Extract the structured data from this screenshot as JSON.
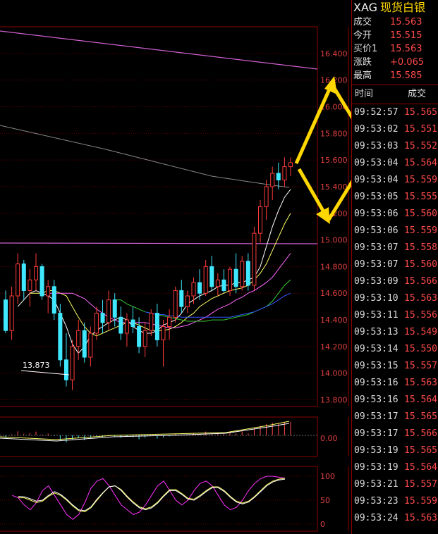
{
  "chart_data": {
    "type": "candlestick",
    "y_ticks_main": [
      "16.400",
      "16.200",
      "16.000",
      "15.800",
      "15.600",
      "15.400",
      "15.200",
      "15.000",
      "14.800",
      "14.600",
      "14.400",
      "14.200",
      "14.000",
      "13.800"
    ],
    "ylim": [
      13.75,
      16.6
    ],
    "annotation_low": "13.873",
    "candles": [
      [
        14.55,
        14.62,
        14.3,
        14.32
      ],
      [
        14.32,
        14.65,
        14.25,
        14.58
      ],
      [
        14.58,
        14.9,
        14.52,
        14.82
      ],
      [
        14.82,
        14.85,
        14.55,
        14.62
      ],
      [
        14.62,
        14.78,
        14.5,
        14.7
      ],
      [
        14.7,
        14.9,
        14.62,
        14.8
      ],
      [
        14.8,
        14.82,
        14.55,
        14.58
      ],
      [
        14.58,
        14.7,
        14.45,
        14.65
      ],
      [
        14.65,
        14.7,
        14.4,
        14.45
      ],
      [
        14.45,
        14.52,
        14.05,
        14.1
      ],
      [
        14.1,
        14.3,
        13.9,
        13.95
      ],
      [
        13.95,
        14.25,
        13.873,
        14.2
      ],
      [
        14.2,
        14.4,
        14.1,
        14.32
      ],
      [
        14.32,
        14.38,
        14.08,
        14.12
      ],
      [
        14.12,
        14.35,
        14.05,
        14.3
      ],
      [
        14.3,
        14.5,
        14.25,
        14.45
      ],
      [
        14.45,
        14.55,
        14.3,
        14.38
      ],
      [
        14.38,
        14.62,
        14.32,
        14.55
      ],
      [
        14.55,
        14.6,
        14.35,
        14.42
      ],
      [
        14.42,
        14.5,
        14.25,
        14.3
      ],
      [
        14.3,
        14.45,
        14.2,
        14.4
      ],
      [
        14.4,
        14.5,
        14.3,
        14.35
      ],
      [
        14.35,
        14.42,
        14.15,
        14.2
      ],
      [
        14.2,
        14.38,
        14.12,
        14.32
      ],
      [
        14.32,
        14.48,
        14.28,
        14.45
      ],
      [
        14.45,
        14.52,
        14.2,
        14.25
      ],
      [
        14.25,
        14.4,
        14.05,
        14.35
      ],
      [
        14.35,
        14.48,
        14.25,
        14.42
      ],
      [
        14.42,
        14.65,
        14.38,
        14.62
      ],
      [
        14.62,
        14.7,
        14.45,
        14.5
      ],
      [
        14.5,
        14.62,
        14.45,
        14.58
      ],
      [
        14.58,
        14.72,
        14.52,
        14.68
      ],
      [
        14.68,
        14.78,
        14.55,
        14.6
      ],
      [
        14.6,
        14.85,
        14.58,
        14.8
      ],
      [
        14.8,
        14.88,
        14.62,
        14.65
      ],
      [
        14.65,
        14.75,
        14.58,
        14.7
      ],
      [
        14.7,
        14.78,
        14.6,
        14.62
      ],
      [
        14.62,
        14.8,
        14.58,
        14.78
      ],
      [
        14.78,
        14.9,
        14.6,
        14.65
      ],
      [
        14.65,
        14.88,
        14.62,
        14.84
      ],
      [
        14.84,
        14.9,
        14.62,
        14.66
      ],
      [
        14.66,
        15.1,
        14.62,
        15.05
      ],
      [
        15.05,
        15.3,
        14.98,
        15.25
      ],
      [
        15.25,
        15.45,
        15.15,
        15.4
      ],
      [
        15.4,
        15.55,
        15.3,
        15.5
      ],
      [
        15.5,
        15.58,
        15.38,
        15.45
      ],
      [
        15.45,
        15.62,
        15.4,
        15.55
      ],
      [
        15.55,
        15.62,
        15.48,
        15.58
      ]
    ],
    "ma_lines": [
      {
        "color": "#ffffff",
        "values": [
          14.5,
          14.55,
          14.6,
          14.62,
          14.6,
          14.58,
          14.55,
          14.45,
          14.35,
          14.22,
          14.15,
          14.2,
          14.28,
          14.32,
          14.35,
          14.38,
          14.4,
          14.42,
          14.4,
          14.35,
          14.32,
          14.3,
          14.3,
          14.32,
          14.36,
          14.38,
          14.4,
          14.45,
          14.52,
          14.55,
          14.58,
          14.6,
          14.62,
          14.65,
          14.66,
          14.66,
          14.68,
          14.68,
          14.7,
          14.72,
          14.8,
          14.95,
          15.1,
          15.22,
          15.32,
          15.38
        ]
      },
      {
        "color": "#ffff66",
        "values": [
          14.6,
          14.6,
          14.6,
          14.62,
          14.62,
          14.6,
          14.58,
          14.5,
          14.42,
          14.35,
          14.3,
          14.28,
          14.3,
          14.32,
          14.34,
          14.36,
          14.38,
          14.38,
          14.36,
          14.34,
          14.32,
          14.32,
          14.32,
          14.33,
          14.35,
          14.38,
          14.42,
          14.45,
          14.5,
          14.53,
          14.56,
          14.58,
          14.6,
          14.62,
          14.63,
          14.64,
          14.66,
          14.7,
          14.75,
          14.82,
          14.92,
          15.02,
          15.12,
          15.2
        ]
      },
      {
        "color": "#ff66ff",
        "values": [
          14.6,
          14.6,
          14.6,
          14.6,
          14.6,
          14.58,
          14.56,
          14.52,
          14.48,
          14.45,
          14.42,
          14.4,
          14.38,
          14.38,
          14.38,
          14.38,
          14.38,
          14.37,
          14.36,
          14.35,
          14.34,
          14.34,
          14.35,
          14.36,
          14.38,
          14.4,
          14.42,
          14.45,
          14.48,
          14.5,
          14.52,
          14.55,
          14.57,
          14.6,
          14.62,
          14.65,
          14.68,
          14.72,
          14.78,
          14.84,
          14.9
        ]
      },
      {
        "color": "#33cc33",
        "values": [
          14.55,
          14.55,
          14.52,
          14.5,
          14.48,
          14.46,
          14.45,
          14.44,
          14.43,
          14.42,
          14.41,
          14.4,
          14.39,
          14.39,
          14.39,
          14.39,
          14.4,
          14.4,
          14.4,
          14.41,
          14.42,
          14.43,
          14.44,
          14.46,
          14.48,
          14.5,
          14.54,
          14.6,
          14.66,
          14.7
        ]
      },
      {
        "color": "#3355ff",
        "values": [
          14.46,
          14.45,
          14.44,
          14.44,
          14.43,
          14.43,
          14.42,
          14.42,
          14.42,
          14.42,
          14.42,
          14.42,
          14.42,
          14.42,
          14.42,
          14.43,
          14.44,
          14.45,
          14.46,
          14.48,
          14.5,
          14.52,
          14.55,
          14.58,
          14.6
        ]
      }
    ],
    "macd_tick": "0.00",
    "kdj_ticks": [
      "100",
      "50",
      "0"
    ],
    "kdj_lines": [
      {
        "color": "#ff33ff",
        "values": [
          60,
          55,
          40,
          30,
          45,
          70,
          80,
          60,
          40,
          20,
          10,
          20,
          45,
          75,
          90,
          95,
          80,
          60,
          40,
          30,
          20,
          25,
          40,
          60,
          80,
          90,
          70,
          50,
          40,
          50,
          70,
          85,
          90,
          80,
          60,
          40,
          30,
          35,
          50,
          70,
          85,
          95,
          100,
          100,
          98,
          96
        ]
      },
      {
        "color": "#ffff66",
        "values": [
          55,
          55,
          50,
          45,
          48,
          58,
          65,
          60,
          50,
          38,
          28,
          26,
          34,
          50,
          65,
          78,
          80,
          72,
          58,
          46,
          36,
          32,
          36,
          46,
          60,
          72,
          72,
          64,
          54,
          52,
          60,
          70,
          78,
          78,
          70,
          58,
          48,
          44,
          48,
          58,
          70,
          82,
          90,
          94,
          96
        ]
      },
      {
        "color": "#ffffff",
        "values": [
          58,
          57,
          53,
          48,
          50,
          60,
          68,
          62,
          52,
          40,
          30,
          28,
          36,
          52,
          66,
          78,
          80,
          70,
          56,
          44,
          34,
          30,
          34,
          44,
          58,
          70,
          70,
          62,
          52,
          50,
          58,
          68,
          76,
          76,
          68,
          56,
          46,
          42,
          46,
          56,
          68,
          80,
          88,
          92,
          94
        ]
      }
    ]
  },
  "quote": {
    "symbol": "XAG",
    "name": "现货白银",
    "rows": [
      {
        "label": "成交",
        "value": "15.563"
      },
      {
        "label": "今开",
        "value": "15.515"
      },
      {
        "label": "买价1",
        "value": "15.563"
      },
      {
        "label": "涨跌",
        "value": "+0.065"
      },
      {
        "label": "最高",
        "value": "15.585"
      }
    ]
  },
  "ticks_header": {
    "time": "时间",
    "price": "成交"
  },
  "ticks": [
    {
      "t": "09:52:57",
      "p": "15.565"
    },
    {
      "t": "09:53:02",
      "p": "15.551"
    },
    {
      "t": "09:53:03",
      "p": "15.552"
    },
    {
      "t": "09:53:04",
      "p": "15.564"
    },
    {
      "t": "09:53:04",
      "p": "15.559"
    },
    {
      "t": "09:53:05",
      "p": "15.555"
    },
    {
      "t": "09:53:06",
      "p": "15.560"
    },
    {
      "t": "09:53:06",
      "p": "15.559"
    },
    {
      "t": "09:53:07",
      "p": "15.558"
    },
    {
      "t": "09:53:07",
      "p": "15.560"
    },
    {
      "t": "09:53:09",
      "p": "15.566"
    },
    {
      "t": "09:53:10",
      "p": "15.563"
    },
    {
      "t": "09:53:11",
      "p": "15.556"
    },
    {
      "t": "09:53:13",
      "p": "15.549"
    },
    {
      "t": "09:53:14",
      "p": "15.550"
    },
    {
      "t": "09:53:15",
      "p": "15.557"
    },
    {
      "t": "09:53:16",
      "p": "15.563"
    },
    {
      "t": "09:53:16",
      "p": "15.564"
    },
    {
      "t": "09:53:17",
      "p": "15.565"
    },
    {
      "t": "09:53:17",
      "p": "15.566"
    },
    {
      "t": "09:53:19",
      "p": "15.565"
    },
    {
      "t": "09:53:19",
      "p": "15.564"
    },
    {
      "t": "09:53:21",
      "p": "15.557"
    },
    {
      "t": "09:53:23",
      "p": "15.559"
    },
    {
      "t": "09:53:24",
      "p": "15.563"
    }
  ]
}
